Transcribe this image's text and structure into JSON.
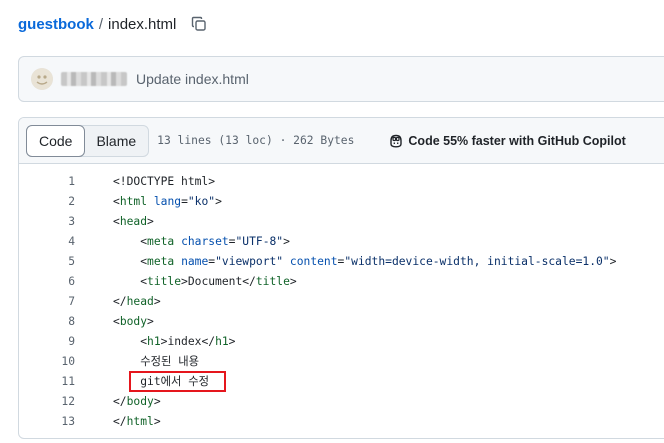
{
  "breadcrumb": {
    "repo": "guestbook",
    "separator": "/",
    "file": "index.html"
  },
  "commit": {
    "message": "Update index.html"
  },
  "file_header": {
    "tabs": [
      {
        "label": "Code",
        "active": true
      },
      {
        "label": "Blame",
        "active": false
      }
    ],
    "info": "13 lines (13 loc) · 262 Bytes",
    "copilot_label": "Code 55% faster with GitHub Copilot"
  },
  "code": {
    "lines": [
      {
        "n": "1",
        "indent": "",
        "parts": [
          [
            "punct",
            "<!DOCTYPE html>"
          ]
        ]
      },
      {
        "n": "2",
        "indent": "",
        "parts": [
          [
            "punct",
            "<"
          ],
          [
            "tag",
            "html"
          ],
          [
            "punct",
            " "
          ],
          [
            "attr",
            "lang"
          ],
          [
            "punct",
            "="
          ],
          [
            "str",
            "\"ko\""
          ],
          [
            "punct",
            ">"
          ]
        ]
      },
      {
        "n": "3",
        "indent": "",
        "parts": [
          [
            "punct",
            "<"
          ],
          [
            "tag",
            "head"
          ],
          [
            "punct",
            ">"
          ]
        ]
      },
      {
        "n": "4",
        "indent": "    ",
        "parts": [
          [
            "punct",
            "<"
          ],
          [
            "tag",
            "meta"
          ],
          [
            "punct",
            " "
          ],
          [
            "attr",
            "charset"
          ],
          [
            "punct",
            "="
          ],
          [
            "str",
            "\"UTF-8\""
          ],
          [
            "punct",
            ">"
          ]
        ]
      },
      {
        "n": "5",
        "indent": "    ",
        "parts": [
          [
            "punct",
            "<"
          ],
          [
            "tag",
            "meta"
          ],
          [
            "punct",
            " "
          ],
          [
            "attr",
            "name"
          ],
          [
            "punct",
            "="
          ],
          [
            "str",
            "\"viewport\""
          ],
          [
            "punct",
            " "
          ],
          [
            "attr",
            "content"
          ],
          [
            "punct",
            "="
          ],
          [
            "str",
            "\"width=device-width, initial-scale=1.0\""
          ],
          [
            "punct",
            ">"
          ]
        ]
      },
      {
        "n": "6",
        "indent": "    ",
        "parts": [
          [
            "punct",
            "<"
          ],
          [
            "tag",
            "title"
          ],
          [
            "punct",
            ">Document</"
          ],
          [
            "tag",
            "title"
          ],
          [
            "punct",
            ">"
          ]
        ]
      },
      {
        "n": "7",
        "indent": "",
        "parts": [
          [
            "punct",
            "</"
          ],
          [
            "tag",
            "head"
          ],
          [
            "punct",
            ">"
          ]
        ]
      },
      {
        "n": "8",
        "indent": "",
        "parts": [
          [
            "punct",
            "<"
          ],
          [
            "tag",
            "body"
          ],
          [
            "punct",
            ">"
          ]
        ]
      },
      {
        "n": "9",
        "indent": "    ",
        "parts": [
          [
            "punct",
            "<"
          ],
          [
            "tag",
            "h1"
          ],
          [
            "punct",
            ">index</"
          ],
          [
            "tag",
            "h1"
          ],
          [
            "punct",
            ">"
          ]
        ]
      },
      {
        "n": "10",
        "indent": "    ",
        "parts": [
          [
            "punct",
            "수정된 내용"
          ]
        ]
      },
      {
        "n": "11",
        "indent": "    ",
        "parts": [
          [
            "punct",
            "git에서 수정"
          ]
        ],
        "highlighted": true
      },
      {
        "n": "12",
        "indent": "",
        "parts": [
          [
            "punct",
            "</"
          ],
          [
            "tag",
            "body"
          ],
          [
            "punct",
            ">"
          ]
        ]
      },
      {
        "n": "13",
        "indent": "",
        "parts": [
          [
            "punct",
            "</"
          ],
          [
            "tag",
            "html"
          ],
          [
            "punct",
            ">"
          ]
        ]
      }
    ]
  },
  "colors": {
    "link": "#0969da",
    "highlight_box": "#e5161d",
    "tag": "#116329",
    "attr": "#0550ae",
    "string": "#0a3069"
  },
  "icons": {
    "copy": "copy-icon",
    "copilot": "copilot-icon",
    "avatar": "avatar"
  }
}
